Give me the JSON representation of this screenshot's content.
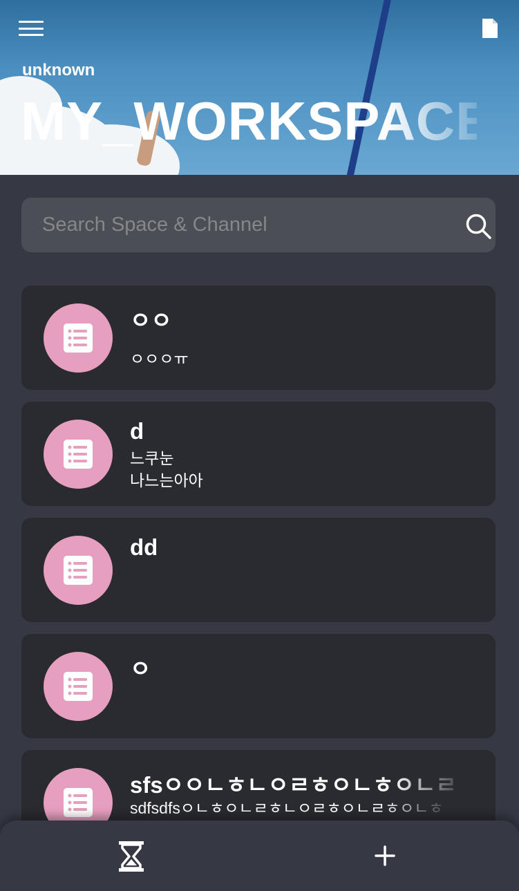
{
  "header": {
    "user_name": "unknown",
    "workspace_title": "MY_WORKSPACE",
    "menu_icon": "hamburger-menu-icon",
    "document_icon": "document-icon"
  },
  "search": {
    "placeholder": "Search Space & Channel",
    "value": "",
    "icon": "search-icon"
  },
  "channels": [
    {
      "title": "ㅇㅇ",
      "subtitle": "ㅇㅇㅇㅠ",
      "icon": "list-icon"
    },
    {
      "title": "d",
      "subtitle": "느쿠눈\n나느는아아",
      "icon": "list-icon"
    },
    {
      "title": "dd",
      "subtitle": "",
      "icon": "list-icon"
    },
    {
      "title": "ㅇ",
      "subtitle": "",
      "icon": "list-icon"
    },
    {
      "title": "sfsㅇㅇㄴㅎㄴㅇㄹㅎㅇㄴㅎㅇㄴㄹ",
      "subtitle": "sdfsdfsㅇㄴㅎㅇㄴㄹㅎㄴㅇㄹㅎㅇㄴㄹㅎㅇㄴㅎ",
      "icon": "list-icon"
    }
  ],
  "bottom_nav": {
    "left_icon": "hourglass-icon",
    "right_icon": "plus-icon"
  },
  "colors": {
    "background": "#363943",
    "card": "#2a2b31",
    "search_box": "#4c4e55",
    "avatar": "#e79fbf",
    "text": "#ffffff",
    "placeholder": "#85878d"
  }
}
